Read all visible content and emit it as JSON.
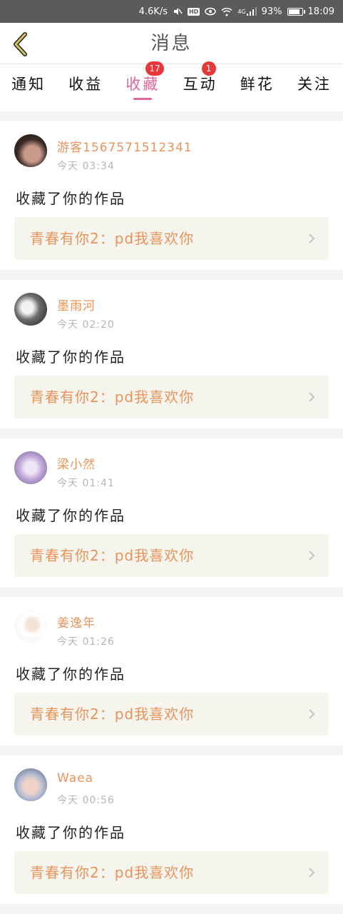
{
  "status_bar": {
    "speed": "4.6K/s",
    "network": "4G",
    "battery": "93%",
    "battery_level": 0.93,
    "time": "18:09",
    "hd_label": "HD"
  },
  "header": {
    "title": "消息"
  },
  "tabs": [
    {
      "label": "通知",
      "badge": ""
    },
    {
      "label": "收益",
      "badge": ""
    },
    {
      "label": "收藏",
      "badge": "17",
      "active": true
    },
    {
      "label": "互动",
      "badge": "1"
    },
    {
      "label": "鲜花",
      "badge": ""
    },
    {
      "label": "关注",
      "badge": ""
    }
  ],
  "items": [
    {
      "user": "游客1567571512341",
      "time": "今天 03:34",
      "action": "收藏了你的作品",
      "work": "青春有你2：pd我喜欢你"
    },
    {
      "user": "墨雨河",
      "time": "今天 02:20",
      "action": "收藏了你的作品",
      "work": "青春有你2：pd我喜欢你"
    },
    {
      "user": "梁小然",
      "time": "今天 01:41",
      "action": "收藏了你的作品",
      "work": "青春有你2：pd我喜欢你"
    },
    {
      "user": "姜逸年",
      "time": "今天 01:26",
      "action": "收藏了你的作品",
      "work": "青春有你2：pd我喜欢你"
    },
    {
      "user": "Waea",
      "time": "今天 00:56",
      "action": "收藏了你的作品",
      "work": "青春有你2：pd我喜欢你"
    }
  ],
  "colors": {
    "accent": "#e0679d",
    "username": "#e8935b",
    "badge": "#e8363b",
    "back_arrow": "#c9b54a"
  }
}
